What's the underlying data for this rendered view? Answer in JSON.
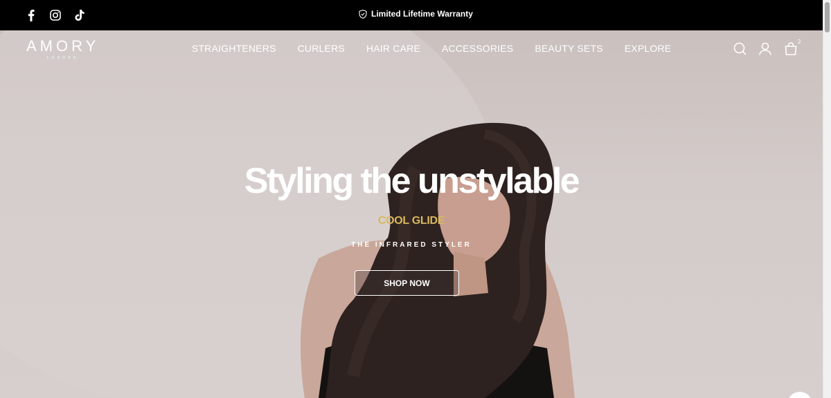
{
  "topbar": {
    "social": [
      {
        "name": "facebook-icon"
      },
      {
        "name": "instagram-icon"
      },
      {
        "name": "tiktok-icon"
      }
    ],
    "warranty_text": "Limited Lifetime Warranty",
    "warranty_icon": "shield-check-icon"
  },
  "header": {
    "logo_text": "AMORY",
    "logo_sub": "LONDON",
    "nav": [
      {
        "label": "STRAIGHTENERS"
      },
      {
        "label": "CURLERS"
      },
      {
        "label": "HAIR CARE"
      },
      {
        "label": "ACCESSORIES"
      },
      {
        "label": "BEAUTY SETS"
      },
      {
        "label": "EXPLORE"
      }
    ],
    "icons": [
      "search-icon",
      "account-icon",
      "cart-icon"
    ],
    "cart_count": "2"
  },
  "hero": {
    "headline": "Styling the unstylable",
    "product": "COOL GLIDE",
    "tagline": "THE INFRARED STYLER",
    "cta": "SHOP NOW"
  },
  "colors": {
    "topbar_bg": "#000000",
    "hero_bg": "#cfc6c4",
    "accent_gold": "#d9b85d",
    "text_white": "#ffffff"
  }
}
